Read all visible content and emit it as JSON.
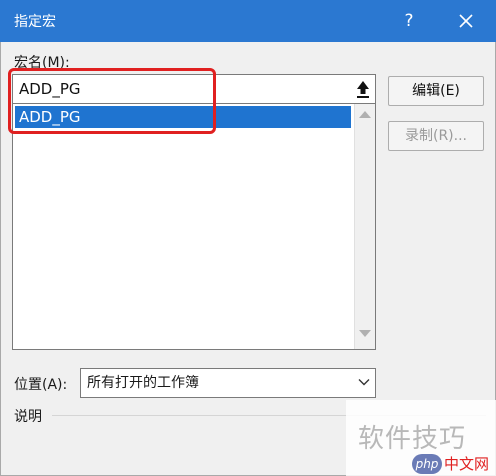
{
  "titlebar": {
    "title": "指定宏",
    "help_label": "?"
  },
  "macro": {
    "label": "宏名(M):",
    "name_value": "ADD_PG",
    "list_items": [
      "ADD_PG"
    ]
  },
  "buttons": {
    "edit_label": "编辑(E)",
    "record_label": "录制(R)..."
  },
  "location": {
    "label": "位置(A):",
    "selected": "所有打开的工作簿"
  },
  "description": {
    "label": "说明"
  },
  "watermark": {
    "text": "软件技巧",
    "logo_php": "php",
    "logo_cn": "中文网"
  },
  "colors": {
    "titlebar": "#2b78d1",
    "selection": "#1f74d0",
    "highlight": "#e02020"
  }
}
